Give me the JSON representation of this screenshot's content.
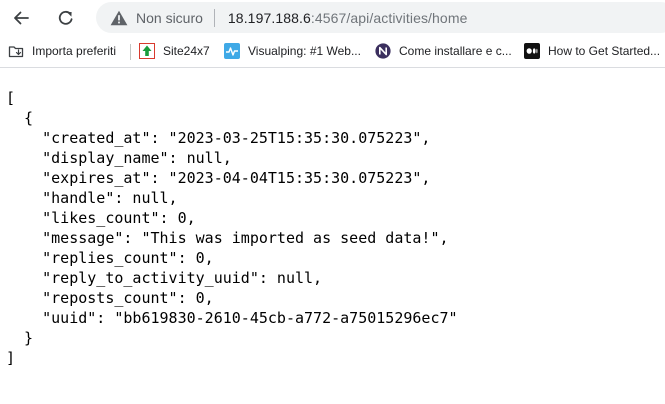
{
  "toolbar": {
    "security_label": "Non sicuro",
    "url_host": "18.197.188.6",
    "url_path": ":4567/api/activities/home"
  },
  "bookmarks": [
    {
      "label": "Importa preferiti",
      "icon": "import-bookmarks-icon"
    },
    {
      "label": "Site24x7",
      "icon": "site24x7-icon"
    },
    {
      "label": "Visualping: #1 Web...",
      "icon": "visualping-icon"
    },
    {
      "label": "Come installare e c...",
      "icon": "come-installare-icon"
    },
    {
      "label": "How to Get Started...",
      "icon": "medium-icon"
    }
  ],
  "json_lines": [
    "[",
    "  {",
    "    \"created_at\": \"2023-03-25T15:35:30.075223\",",
    "    \"display_name\": null,",
    "    \"expires_at\": \"2023-04-04T15:35:30.075223\",",
    "    \"handle\": null,",
    "    \"likes_count\": 0,",
    "    \"message\": \"This was imported as seed data!\",",
    "    \"replies_count\": 0,",
    "    \"reply_to_activity_uuid\": null,",
    "    \"reposts_count\": 0,",
    "    \"uuid\": \"bb619830-2610-45cb-a772-a75015296ec7\"",
    "  }",
    "]"
  ]
}
